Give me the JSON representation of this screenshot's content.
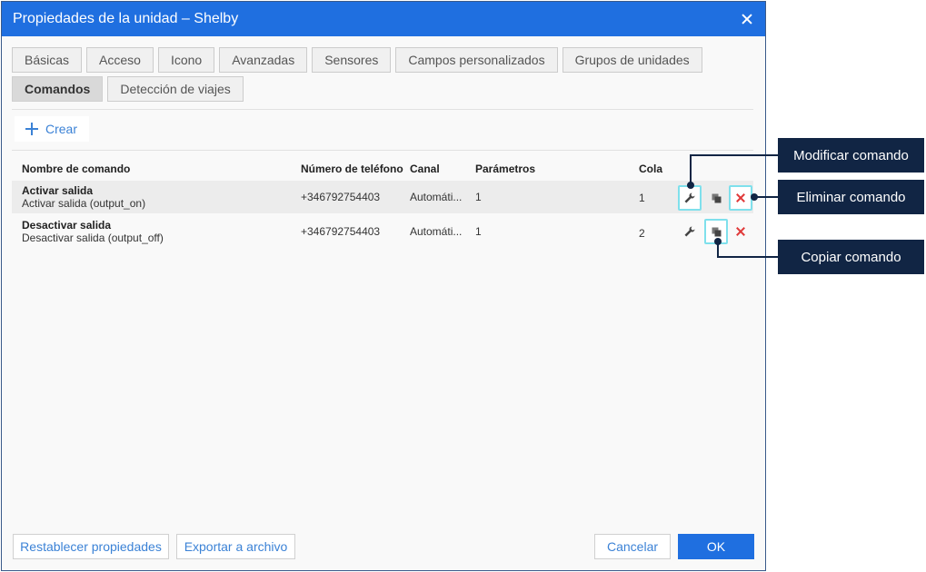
{
  "dialog": {
    "title": "Propiedades de la unidad – Shelby"
  },
  "tabs": {
    "row1": [
      "Básicas",
      "Acceso",
      "Icono",
      "Avanzadas",
      "Sensores",
      "Campos personalizados",
      "Grupos de unidades"
    ],
    "row2": [
      "Comandos",
      "Detección de viajes"
    ],
    "active": "Comandos"
  },
  "toolbar": {
    "create_label": "Crear"
  },
  "table": {
    "headers": {
      "name": "Nombre de comando",
      "phone": "Número de teléfono",
      "channel": "Canal",
      "params": "Parámetros",
      "queue": "Cola"
    },
    "rows": [
      {
        "title": "Activar salida",
        "subtitle": "Activar salida (output_on)",
        "phone": "+346792754403",
        "channel": "Automáti...",
        "params": "1",
        "queue": "1"
      },
      {
        "title": "Desactivar salida",
        "subtitle": "Desactivar salida (output_off)",
        "phone": "+346792754403",
        "channel": "Automáti...",
        "params": "1",
        "queue": "2"
      }
    ]
  },
  "footer": {
    "reset_label": "Restablecer propiedades",
    "export_label": "Exportar a archivo",
    "cancel_label": "Cancelar",
    "ok_label": "OK"
  },
  "callouts": {
    "modify": "Modificar comando",
    "delete": "Eliminar comando",
    "copy": "Copiar comando"
  },
  "colors": {
    "title_bar": "#1f6fe0",
    "link_blue": "#3b82d6",
    "delete_red": "#e03a3a",
    "callout_bg": "#112544",
    "highlight": "#7fe0ec"
  },
  "icons": {
    "close": "close-icon",
    "create": "plus-icon",
    "modify": "wrench-icon",
    "copy": "copy-icon",
    "delete": "x-icon"
  }
}
